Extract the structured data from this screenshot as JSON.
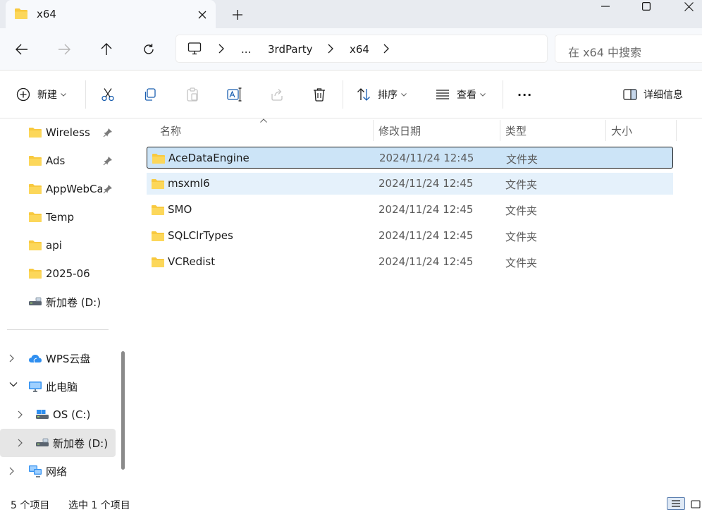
{
  "window": {
    "tab_title": "x64",
    "colors": {
      "accent": "#0067c0",
      "folder": "#f8c93f",
      "selected_row": "#cce4f7"
    }
  },
  "address": {
    "crumbs": [
      "...",
      "3rdParty",
      "x64"
    ]
  },
  "search": {
    "placeholder": "在 x64 中搜索"
  },
  "toolbar": {
    "new_label": "新建",
    "sort_label": "排序",
    "view_label": "查看",
    "more_label": "···",
    "details_label": "详细信息"
  },
  "sidebar": {
    "quick": [
      {
        "label": "Wireless",
        "icon": "folder-icon",
        "pinned": true
      },
      {
        "label": "Ads",
        "icon": "folder-icon",
        "pinned": true
      },
      {
        "label": "AppWebCache",
        "icon": "folder-icon",
        "pinned": true
      },
      {
        "label": "Temp",
        "icon": "folder-icon",
        "pinned": false
      },
      {
        "label": "api",
        "icon": "folder-icon",
        "pinned": false
      },
      {
        "label": "2025-06",
        "icon": "folder-icon",
        "pinned": false
      },
      {
        "label": "新加卷 (D:)",
        "icon": "drive-icon",
        "pinned": false
      }
    ],
    "tree": [
      {
        "label": "WPS云盘",
        "icon": "cloud-icon",
        "expanded": false
      },
      {
        "label": "此电脑",
        "icon": "computer-icon",
        "expanded": true
      },
      {
        "label": "OS (C:)",
        "icon": "drive-icon",
        "expanded": false
      },
      {
        "label": "新加卷 (D:)",
        "icon": "drive-icon",
        "expanded": false,
        "selected": true
      },
      {
        "label": "网络",
        "icon": "network-icon",
        "expanded": false
      }
    ]
  },
  "columns": {
    "name": "名称",
    "modified": "修改日期",
    "type": "类型",
    "size": "大小"
  },
  "files": [
    {
      "name": "AceDataEngine",
      "modified": "2024/11/24 12:45",
      "type": "文件夹",
      "state": "selected"
    },
    {
      "name": "msxml6",
      "modified": "2024/11/24 12:45",
      "type": "文件夹",
      "state": "hover"
    },
    {
      "name": "SMO",
      "modified": "2024/11/24 12:45",
      "type": "文件夹",
      "state": ""
    },
    {
      "name": "SQLClrTypes",
      "modified": "2024/11/24 12:45",
      "type": "文件夹",
      "state": ""
    },
    {
      "name": "VCRedist",
      "modified": "2024/11/24 12:45",
      "type": "文件夹",
      "state": ""
    }
  ],
  "status": {
    "count": "5 个项目",
    "selection": "选中 1 个项目"
  }
}
